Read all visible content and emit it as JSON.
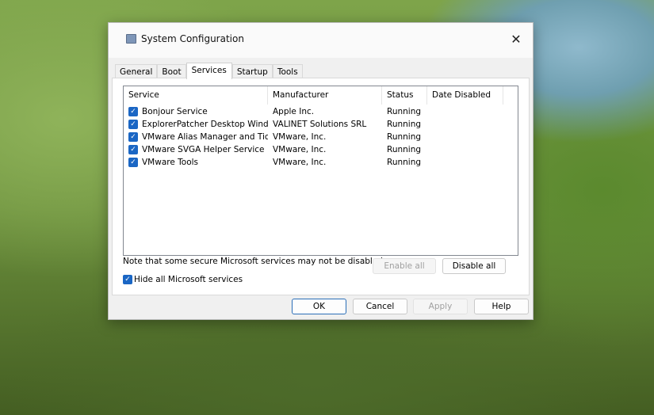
{
  "window": {
    "title": "System Configuration",
    "close_label": "✕"
  },
  "tabs": [
    "General",
    "Boot",
    "Services",
    "Startup",
    "Tools"
  ],
  "active_tab": "Services",
  "columns": [
    "Service",
    "Manufacturer",
    "Status",
    "Date Disabled"
  ],
  "rows": [
    {
      "service": "Bonjour Service",
      "manufacturer": "Apple Inc.",
      "status": "Running",
      "date_disabled": "",
      "checked": true
    },
    {
      "service": "ExplorerPatcher Desktop Windo...",
      "manufacturer": "VALINET Solutions SRL",
      "status": "Running",
      "date_disabled": "",
      "checked": true
    },
    {
      "service": "VMware Alias Manager and Ticke...",
      "manufacturer": "VMware, Inc.",
      "status": "Running",
      "date_disabled": "",
      "checked": true
    },
    {
      "service": "VMware SVGA Helper Service",
      "manufacturer": "VMware, Inc.",
      "status": "Running",
      "date_disabled": "",
      "checked": true
    },
    {
      "service": "VMware Tools",
      "manufacturer": "VMware, Inc.",
      "status": "Running",
      "date_disabled": "",
      "checked": true
    }
  ],
  "note": "Note that some secure Microsoft services may not be disabled.",
  "enable_all": "Enable all",
  "disable_all": "Disable all",
  "hide_ms": {
    "label": "Hide all Microsoft services",
    "checked": true
  },
  "footer": {
    "ok": "OK",
    "cancel": "Cancel",
    "apply": "Apply",
    "help": "Help"
  },
  "checkmark": "✓"
}
